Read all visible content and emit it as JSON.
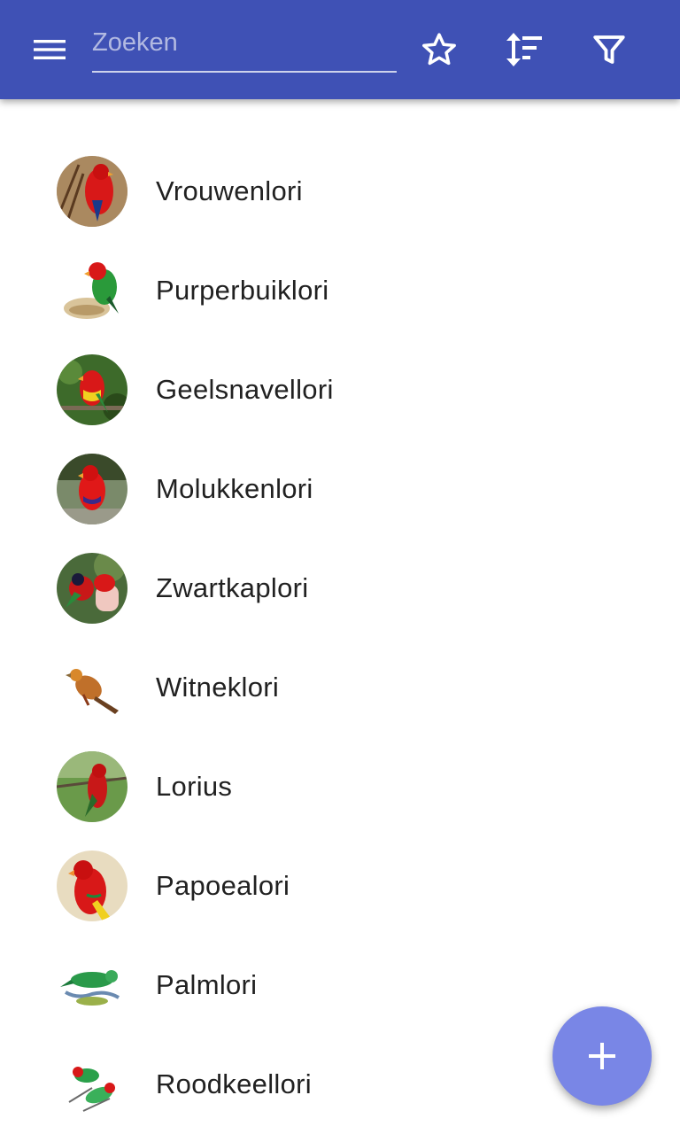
{
  "toolbar": {
    "menu_icon": "menu-icon",
    "search": {
      "placeholder": "Zoeken",
      "value": ""
    },
    "favorite_icon": "star-outline-icon",
    "sort_icon": "sort-icon",
    "filter_icon": "filter-icon",
    "bg_color": "#3f51b5"
  },
  "list": {
    "items": [
      {
        "label": "Vrouwenlori",
        "avatar": "bird-photo"
      },
      {
        "label": "Purperbuiklori",
        "avatar": "bird-photo"
      },
      {
        "label": "Geelsnavellori",
        "avatar": "bird-photo"
      },
      {
        "label": "Molukkenlori",
        "avatar": "bird-photo"
      },
      {
        "label": "Zwartkaplori",
        "avatar": "bird-photo"
      },
      {
        "label": "Witneklori",
        "avatar": "bird-photo"
      },
      {
        "label": "Lorius",
        "avatar": "bird-photo"
      },
      {
        "label": "Papoealori",
        "avatar": "bird-photo"
      },
      {
        "label": "Palmlori",
        "avatar": "bird-illustration"
      },
      {
        "label": "Roodkeellori",
        "avatar": "bird-illustration"
      }
    ]
  },
  "fab": {
    "icon": "plus-icon",
    "color": "#7986e6"
  }
}
